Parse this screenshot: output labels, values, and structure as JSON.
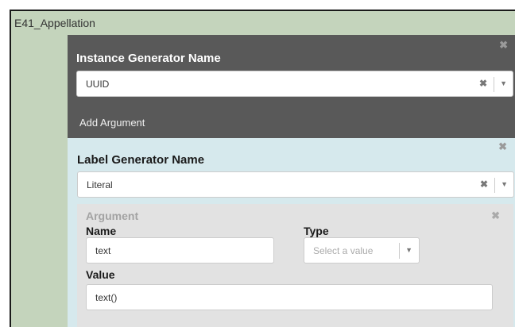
{
  "entity": {
    "title": "E41_Appellation"
  },
  "instance_generator": {
    "title": "Instance Generator Name",
    "selected": "UUID",
    "add_argument_label": "Add Argument",
    "close_symbol": "✖",
    "clear_symbol": "✖",
    "arrow_symbol": "▼"
  },
  "label_generator": {
    "title": "Label Generator Name",
    "selected": "Literal",
    "close_symbol": "✖",
    "clear_symbol": "✖",
    "arrow_symbol": "▼",
    "argument": {
      "heading": "Argument",
      "close_symbol": "✖",
      "name_label": "Name",
      "name_value": "text",
      "type_label": "Type",
      "type_placeholder": "Select a value",
      "type_arrow": "▼",
      "value_label": "Value",
      "value_value": "text()"
    }
  }
}
